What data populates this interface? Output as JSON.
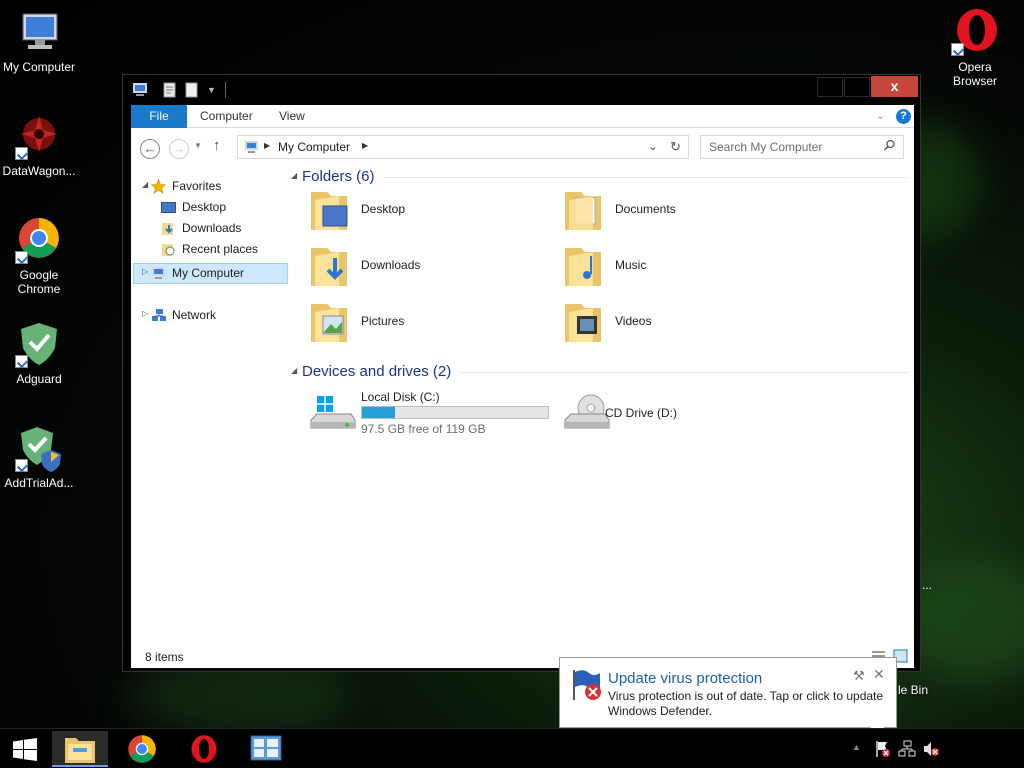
{
  "desktop": {
    "icons_left": [
      {
        "label": "My Computer",
        "icon": "computer-icon"
      },
      {
        "label": "DataWagon...",
        "icon": "datawagon-icon"
      },
      {
        "label": "Google Chrome",
        "icon": "chrome-icon"
      },
      {
        "label": "Adguard",
        "icon": "adguard-icon"
      },
      {
        "label": "AddTrialAd...",
        "icon": "addtrial-icon"
      }
    ],
    "icons_right": [
      {
        "label": "Opera Browser",
        "icon": "opera-icon"
      }
    ],
    "partial_recycle_label": "le Bin",
    "partial_dots": "..."
  },
  "window": {
    "close_glyph": "x",
    "ribbon_tabs": [
      "File",
      "Computer",
      "View"
    ],
    "help_glyph": "?",
    "address": "My Computer",
    "search_placeholder": "Search My Computer",
    "nav": {
      "favorites": "Favorites",
      "favorites_items": [
        "Desktop",
        "Downloads",
        "Recent places"
      ],
      "my_computer": "My Computer",
      "network": "Network"
    },
    "folders_header": "Folders (6)",
    "folders": [
      "Desktop",
      "Documents",
      "Downloads",
      "Music",
      "Pictures",
      "Videos"
    ],
    "devices_header": "Devices and drives (2)",
    "drives": [
      {
        "name": "Local Disk (C:)",
        "free_text": "97.5 GB free of 119 GB",
        "used_fraction": 0.18
      },
      {
        "name": "CD Drive (D:)"
      }
    ],
    "status": "8 items"
  },
  "toast": {
    "title": "Update virus protection",
    "body": "Virus protection is out of date. Tap or click to update Windows Defender."
  },
  "taskbar": {
    "apps": [
      "start-icon",
      "file-explorer-icon",
      "chrome-icon",
      "opera-icon",
      "control-panel-icon"
    ]
  },
  "colors": {
    "accent": "#1979ca",
    "close_red": "#c7463b",
    "group_header": "#1e3287",
    "drive_bar": "#26a0da"
  }
}
